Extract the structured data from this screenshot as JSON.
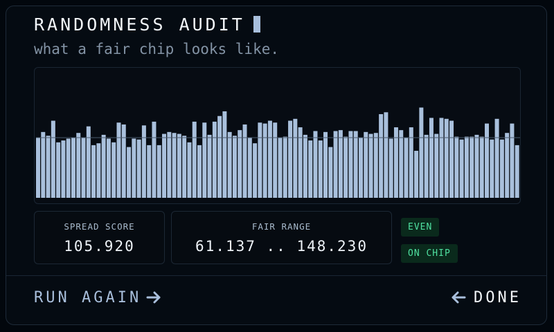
{
  "header": {
    "title": "RANDOMNESS AUDIT",
    "subtitle": "what a fair chip looks like."
  },
  "stats": {
    "spread_label": "SPREAD SCORE",
    "spread_value": "105.920",
    "range_label": "FAIR RANGE",
    "range_value": "61.137 .. 148.230"
  },
  "badges": {
    "even": "EVEN",
    "on_chip": "ON CHIP"
  },
  "actions": {
    "run_again": "RUN AGAIN",
    "done": "DONE"
  },
  "colors": {
    "bar": "#a9c0dc",
    "reference_line": "#4a5a6c",
    "badge_text": "#4fe0a0",
    "run_again_text": "#a9bfdc",
    "done_text": "#f2f5f8"
  },
  "icons": {
    "run_again": "arrow-right-icon",
    "done": "arrow-left-icon"
  },
  "chart_data": {
    "type": "bar",
    "ylim": [
      0,
      128
    ],
    "reference_value": 64,
    "values": [
      64,
      70,
      66,
      82,
      59,
      61,
      63,
      64,
      69,
      64,
      76,
      56,
      58,
      67,
      63,
      59,
      80,
      78,
      54,
      63,
      62,
      77,
      56,
      81,
      56,
      68,
      70,
      69,
      68,
      66,
      59,
      81,
      56,
      80,
      67,
      81,
      87,
      92,
      70,
      66,
      72,
      78,
      64,
      58,
      80,
      79,
      82,
      80,
      64,
      65,
      82,
      84,
      75,
      67,
      61,
      71,
      61,
      70,
      54,
      71,
      72,
      65,
      71,
      71,
      64,
      70,
      68,
      69,
      89,
      91,
      63,
      75,
      72,
      64,
      75,
      50,
      96,
      67,
      85,
      68,
      85,
      84,
      82,
      65,
      62,
      65,
      65,
      67,
      65,
      79,
      62,
      84,
      62,
      69,
      79,
      56
    ]
  }
}
